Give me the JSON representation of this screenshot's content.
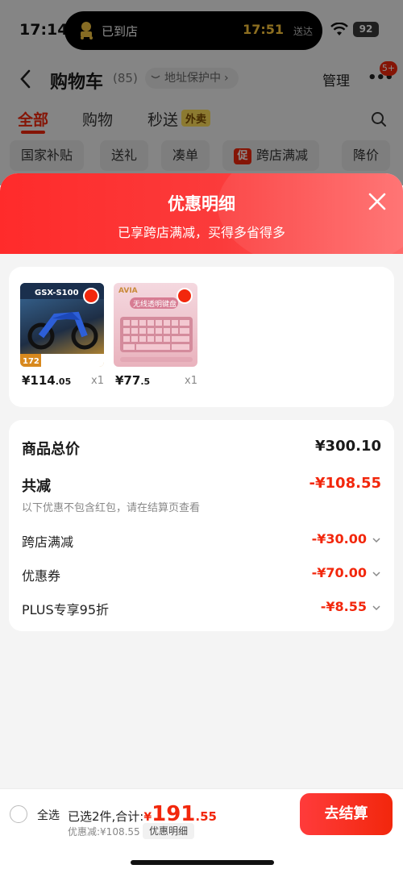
{
  "status_bar": {
    "time": "17:14",
    "island_text": "已到店",
    "island_time": "17:51",
    "island_suffix": "送达",
    "battery": "92"
  },
  "nav": {
    "title": "购物车",
    "count": "(85)",
    "address_protect": "地址保护中",
    "manage": "管理",
    "badge": "5+"
  },
  "tabs": [
    {
      "label": "全部"
    },
    {
      "label": "购物"
    },
    {
      "label": "秒送",
      "tag": "外卖"
    }
  ],
  "chips": [
    {
      "label": "国家补贴"
    },
    {
      "label": "送礼"
    },
    {
      "label": "凑单"
    },
    {
      "label": "跨店满减",
      "tag": "促"
    },
    {
      "label": "降价"
    }
  ],
  "sheet": {
    "title": "优惠明细",
    "subtitle": "已享跨店满减，买得多省得多",
    "products": [
      {
        "thumb_text": "GSX-S100",
        "price_int": "¥114",
        "price_dec": ".05",
        "qty": "x1",
        "bg_color": "#2b4a6e",
        "thumb_label": "172"
      },
      {
        "thumb_text": "无线透明键盘",
        "price_int": "¥77",
        "price_dec": ".5",
        "qty": "x1",
        "bg_color": "#e9b2bd",
        "thumb_label": "AVIA"
      }
    ],
    "total_label": "商品总价",
    "total_value": "¥300.10",
    "reduce_label": "共减",
    "reduce_value": "-¥108.55",
    "note": "以下优惠不包含红包，请在结算页查看",
    "lines": [
      {
        "label": "跨店满减",
        "value": "-¥30.00"
      },
      {
        "label": "优惠券",
        "value": "-¥70.00"
      },
      {
        "label": "PLUS专享95折",
        "value": "-¥8.55"
      }
    ]
  },
  "bottom": {
    "select_all": "全选",
    "selected_text": "已选2件,合计:",
    "yen": "¥",
    "price_int": "191",
    "price_dec": ".55",
    "saved": "优惠减:¥108.55",
    "detail_btn": "优惠明细",
    "checkout": "去结算"
  },
  "colors": {
    "accent": "#f2270c",
    "header_gradient_start": "#ff2b2b",
    "header_gradient_end": "#ff6a6a"
  }
}
